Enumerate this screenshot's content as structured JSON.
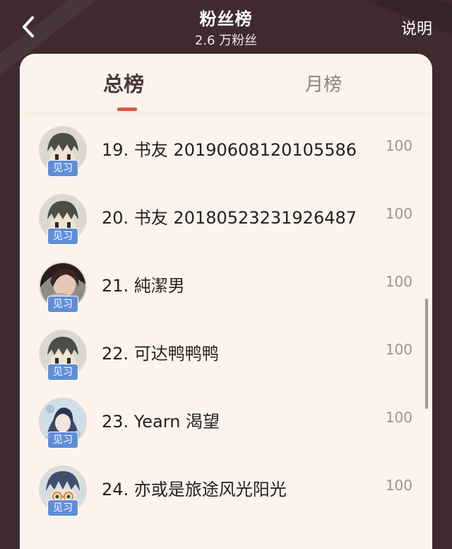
{
  "header": {
    "title": "粉丝榜",
    "subtitle": "2.6 万粉丝",
    "explain_label": "说明"
  },
  "tabs": [
    {
      "label": "总榜",
      "active": true
    },
    {
      "label": "月榜",
      "active": false
    }
  ],
  "colors": {
    "background": "#3e2a2f",
    "card": "#fdf3ed",
    "accent": "#d9574b",
    "badge": "#5f8ed9"
  },
  "fans": [
    {
      "rank_name": "19. 书友 20190608120105586",
      "badge": "见习",
      "score": "100",
      "avatar": "cartoon-boy"
    },
    {
      "rank_name": "20. 书友 20180523231926487",
      "badge": "见习",
      "score": "100",
      "avatar": "cartoon-boy"
    },
    {
      "rank_name": "21. 純潔男",
      "badge": "见习",
      "score": "100",
      "avatar": "photo-girl-cat"
    },
    {
      "rank_name": "22. 可达鸭鸭鸭",
      "badge": "见习",
      "score": "100",
      "avatar": "cartoon-boy"
    },
    {
      "rank_name": "23. Yearn 渴望",
      "badge": "见习",
      "score": "100",
      "avatar": "anime-girl"
    },
    {
      "rank_name": "24. 亦或是旅途风光阳光",
      "badge": "见习",
      "score": "100",
      "avatar": "cartoon-boy-glasses"
    }
  ]
}
